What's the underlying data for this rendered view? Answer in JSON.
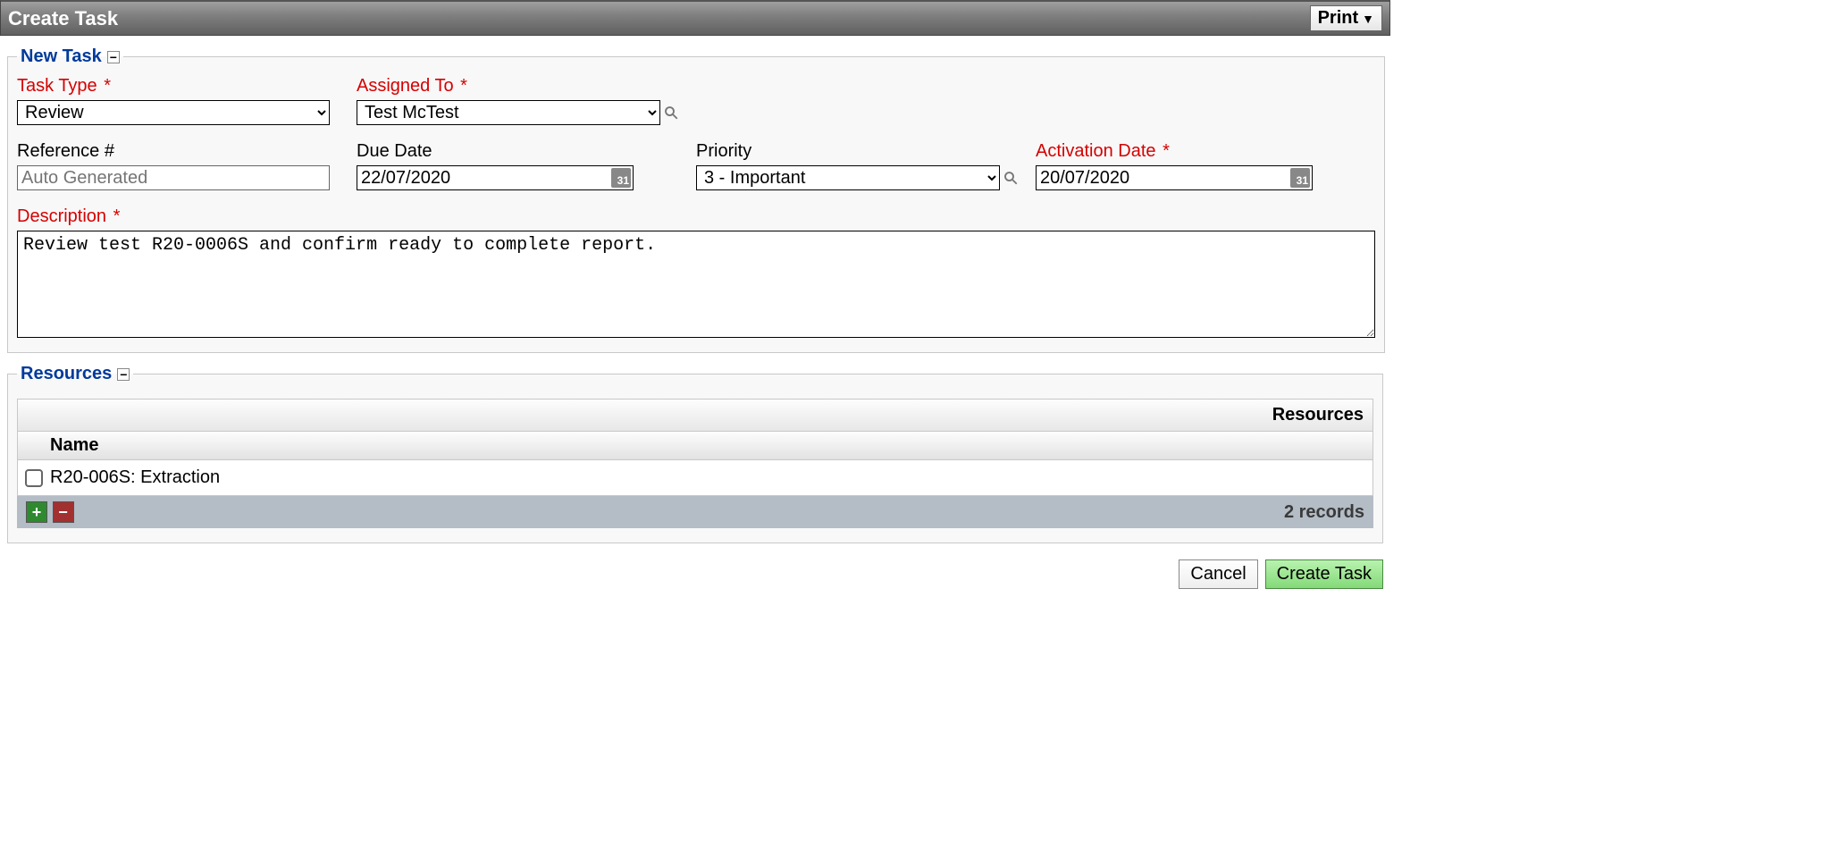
{
  "header": {
    "title": "Create Task",
    "print_label": "Print"
  },
  "new_task": {
    "legend": "New Task",
    "task_type": {
      "label": "Task Type",
      "value": "Review"
    },
    "assigned_to": {
      "label": "Assigned To",
      "value": "Test McTest"
    },
    "reference": {
      "label": "Reference #",
      "placeholder": "Auto Generated",
      "value": ""
    },
    "due_date": {
      "label": "Due Date",
      "value": "22/07/2020"
    },
    "priority": {
      "label": "Priority",
      "value": "3 - Important"
    },
    "activation_date": {
      "label": "Activation Date",
      "value": "20/07/2020"
    },
    "description": {
      "label": "Description",
      "value": "Review test R20-0006S and confirm ready to complete report."
    },
    "cal_text": "31"
  },
  "resources": {
    "legend": "Resources",
    "title_right": "Resources",
    "col_name": "Name",
    "rows": [
      {
        "name": "R20-006S: Extraction"
      }
    ],
    "records_text": "2 records"
  },
  "footer": {
    "cancel": "Cancel",
    "create": "Create Task"
  }
}
